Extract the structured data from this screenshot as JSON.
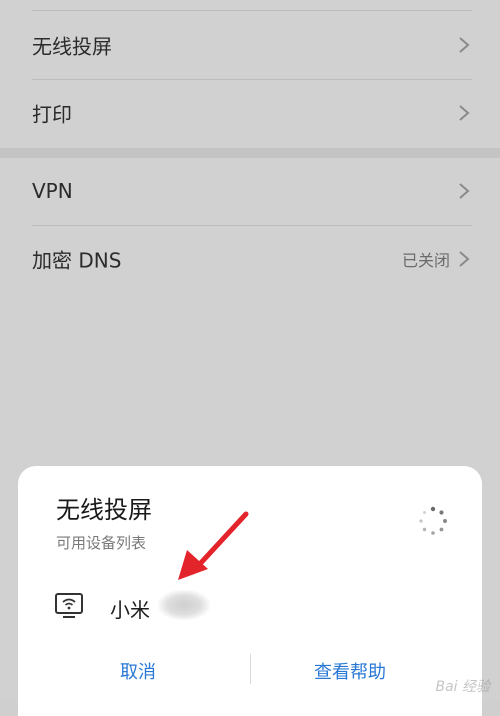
{
  "settings": {
    "items": [
      {
        "label": "无线投屏",
        "status": ""
      },
      {
        "label": "打印",
        "status": ""
      },
      {
        "label": "VPN",
        "status": ""
      },
      {
        "label": "加密 DNS",
        "status": "已关闭"
      }
    ]
  },
  "sheet": {
    "title": "无线投屏",
    "subtitle": "可用设备列表",
    "devices": [
      {
        "name": "小米",
        "icon": "tv-wifi-icon"
      }
    ],
    "actions": {
      "cancel": "取消",
      "help": "查看帮助"
    },
    "loading_icon": "spinner-icon"
  },
  "annotation": {
    "arrow_color": "#e4242b"
  },
  "watermark": {
    "text": "Bai 经验"
  },
  "colors": {
    "accent": "#2a78d6"
  }
}
